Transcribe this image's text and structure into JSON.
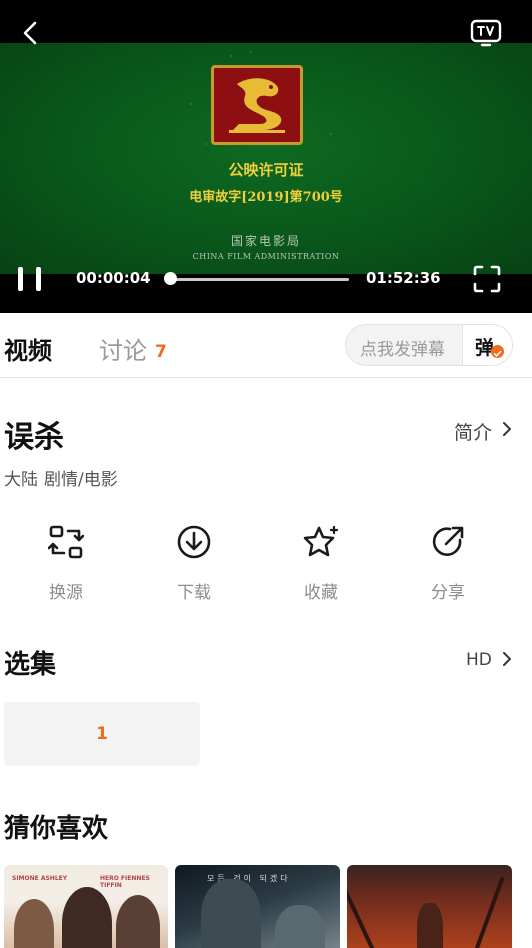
{
  "player": {
    "certificate_title": "公映许可证",
    "certificate_number": "电审故字[2019]第700号",
    "bureau_cn": "国家电影局",
    "bureau_en": "CHINA FILM ADMINISTRATION",
    "current_time": "00:00:04",
    "total_time": "01:52:36",
    "progress": 0.0006
  },
  "tabs": {
    "video": "视频",
    "discuss": "讨论",
    "discuss_count": "7"
  },
  "danmu": {
    "placeholder": "点我发弹幕",
    "button": "弹"
  },
  "movie": {
    "title": "误杀",
    "intro_label": "简介",
    "region": "大陆",
    "genre": "剧情/电影"
  },
  "actions": [
    {
      "label": "换源",
      "icon": "switch-source-icon"
    },
    {
      "label": "下载",
      "icon": "download-icon"
    },
    {
      "label": "收藏",
      "icon": "favorite-star-icon"
    },
    {
      "label": "分享",
      "icon": "share-icon"
    }
  ],
  "episodes": {
    "title": "选集",
    "quality": "HD",
    "items": [
      "1"
    ]
  },
  "recommend": {
    "title": "猜你喜欢",
    "poster1_credit_left": "SIMONE ASHLEY",
    "poster1_credit_right": "HERO FIENNES TIFFIN",
    "poster2_text": "모든 것이 되겠다"
  },
  "colors": {
    "accent": "#f26a1b",
    "player_bg": "#000000",
    "license_green": "#0a5a1c"
  }
}
